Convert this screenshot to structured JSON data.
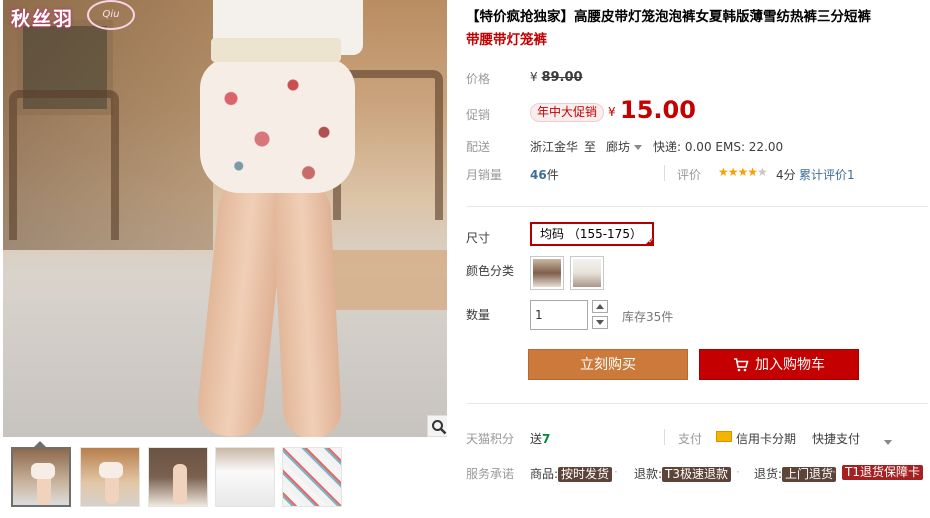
{
  "gallery": {
    "logo_text": "秋丝羽",
    "logo_mark": "Qiu",
    "thumbnails": [
      "thumb-1",
      "thumb-2",
      "thumb-3",
      "thumb-4",
      "thumb-5"
    ],
    "active_thumbnail": 1
  },
  "product": {
    "title_prefix": "【特价疯抢独家】",
    "title_main": "高腰皮带灯笼泡泡裤女夏韩版薄雪纺热裤三分短裤",
    "title_tail": "带腰带灯笼裤"
  },
  "price": {
    "label": "价格",
    "currency": "¥",
    "original": "89.00"
  },
  "promo": {
    "label": "促销",
    "badge": "年中大促销",
    "currency": "¥",
    "price": "15.00"
  },
  "shipping": {
    "label": "配送",
    "from": "浙江金华",
    "to_word": "至",
    "to": "廊坊",
    "fees": "快递: 0.00 EMS: 22.00"
  },
  "sales": {
    "label": "月销量",
    "count": "46",
    "unit": "件",
    "rating_label": "评价",
    "stars_filled": "★★★★",
    "stars_empty": "★",
    "score": "4分",
    "review_text": "累计评价1"
  },
  "options": {
    "size_label": "尺寸",
    "size_value": "均码 （155-175）",
    "color_label": "颜色分类",
    "qty_label": "数量",
    "qty_value": "1",
    "stock": "库存35件"
  },
  "buttons": {
    "buy": "立刻购买",
    "cart": "加入购物车"
  },
  "extras": {
    "points_label": "天猫积分",
    "points_prefix": "送",
    "points_value": "7",
    "pay_label": "支付",
    "card_text": "信用卡分期",
    "quick_pay": "快捷支付",
    "service_label": "服务承诺",
    "svc1_label": "商品:",
    "svc1_tag": "按时发货",
    "svc2_label": "退款:",
    "svc2_tag": "T3极速退款",
    "svc3_label": "退货:",
    "svc3_tag": "上门退货",
    "svc4_tag": "T1退货保障卡"
  },
  "colors": {
    "accent_red": "#c40000",
    "buy_orange": "#cc7a3b",
    "link_blue": "#3c6e9a",
    "points_green": "#00893d"
  }
}
